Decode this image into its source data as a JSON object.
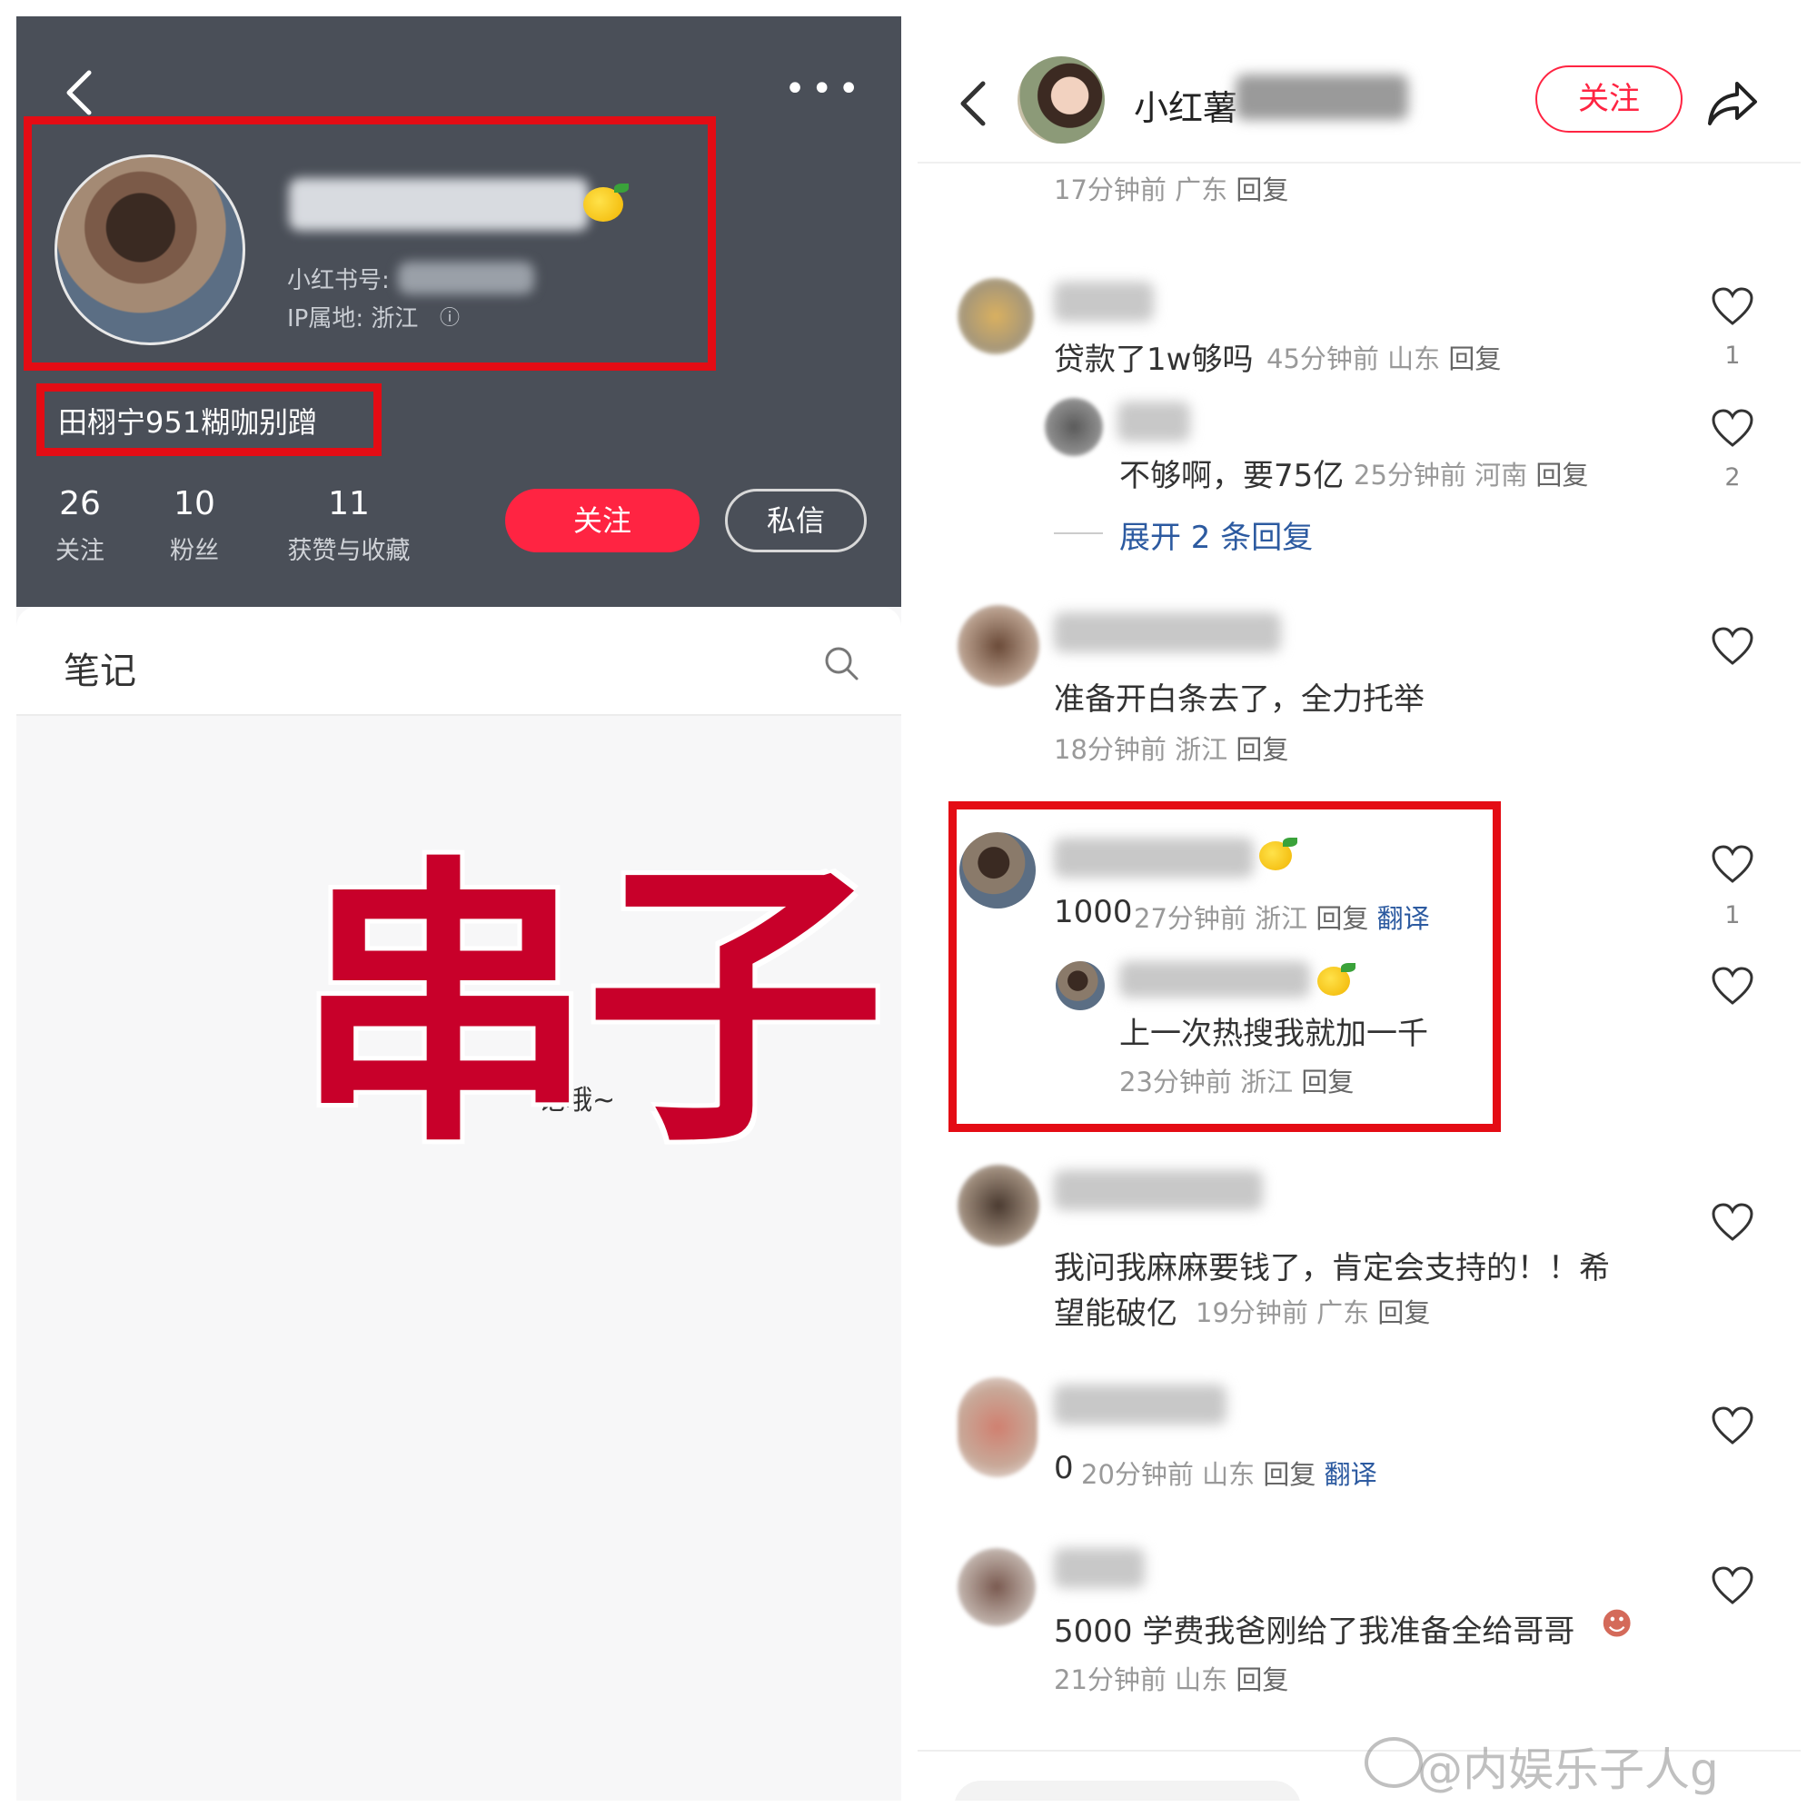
{
  "left": {
    "profile": {
      "id_label": "小红书号:",
      "ip_label": "IP属地: 浙江",
      "bio": "田栩宁951糊咖别蹭"
    },
    "stats": [
      {
        "value": "26",
        "label": "关注"
      },
      {
        "value": "10",
        "label": "粉丝"
      },
      {
        "value": "11",
        "label": "获赞与收藏"
      }
    ],
    "buttons": {
      "follow": "关注",
      "message": "私信"
    },
    "tabs": {
      "notes": "笔记"
    },
    "empty_hint": "记哦~",
    "overlay": "串子"
  },
  "right": {
    "author": {
      "name": "小红薯"
    },
    "follow": "关注",
    "top_meta": {
      "time": "17分钟前",
      "location": "广东",
      "reply": "回复"
    },
    "comments": [
      {
        "text": "贷款了1w够吗",
        "time": "45分钟前",
        "location": "山东",
        "reply": "回复",
        "likes": "1",
        "sub": {
          "text": "不够啊，要75亿",
          "time": "25分钟前",
          "location": "河南",
          "reply": "回复",
          "likes": "2"
        },
        "expand": "展开 2 条回复"
      },
      {
        "text": "准备开白条去了，全力托举",
        "time": "18分钟前",
        "location": "浙江",
        "reply": "回复"
      },
      {
        "text": "1000",
        "time": "27分钟前",
        "location": "浙江",
        "reply": "回复",
        "translate": "翻译",
        "likes": "1",
        "sub": {
          "text": "上一次热搜我就加一千",
          "time": "23分钟前",
          "location": "浙江",
          "reply": "回复"
        }
      },
      {
        "text_line1": "我问我麻麻要钱了，肯定会支持的！！希",
        "text_line2": "望能破亿",
        "time": "19分钟前",
        "location": "广东",
        "reply": "回复"
      },
      {
        "text": "0",
        "time": "20分钟前",
        "location": "山东",
        "reply": "回复",
        "translate": "翻译"
      },
      {
        "text": "5000 学费我爸刚给了我准备全给哥哥",
        "time": "21分钟前",
        "location": "山东",
        "reply": "回复"
      }
    ]
  },
  "watermark": "@内娱乐子人g",
  "colors": {
    "accent": "#ff2442",
    "highlight_box": "#e40c14",
    "overlay": "#c8002a",
    "link": "#2c5aa0"
  }
}
